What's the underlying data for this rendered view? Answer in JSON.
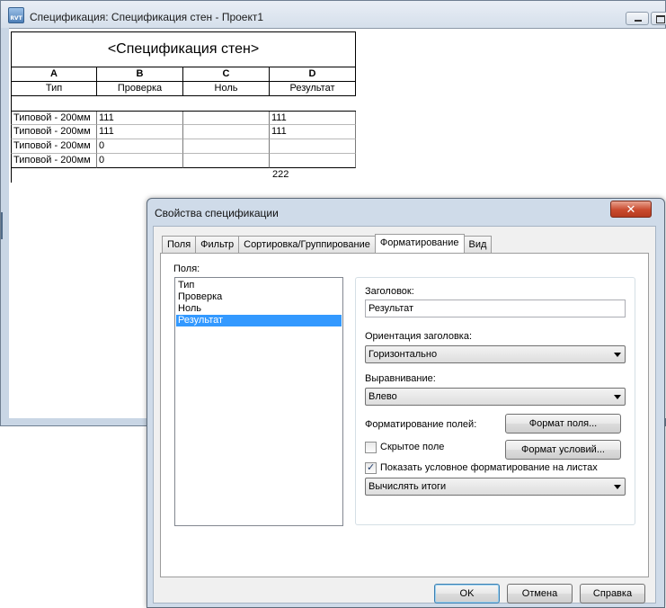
{
  "main_window": {
    "title": "Спецификация: Спецификация стен - Проект1",
    "icon_text": "RVT"
  },
  "schedule": {
    "title": "<Спецификация стен>",
    "column_letters": [
      "A",
      "B",
      "C",
      "D"
    ],
    "headers": [
      "Тип",
      "Проверка",
      "Ноль",
      "Результат"
    ],
    "rows": [
      [
        "Типовой - 200мм",
        "111",
        "",
        "111"
      ],
      [
        "Типовой - 200мм",
        "111",
        "",
        "111"
      ],
      [
        "Типовой - 200мм",
        "0",
        "",
        ""
      ],
      [
        "Типовой - 200мм",
        "0",
        "",
        ""
      ]
    ],
    "total": "222"
  },
  "dialog": {
    "title": "Свойства спецификации",
    "close_glyph": "✕",
    "tabs": [
      "Поля",
      "Фильтр",
      "Сортировка/Группирование",
      "Форматирование",
      "Вид"
    ],
    "active_tab": "Форматирование",
    "fields_label": "Поля:",
    "fields": [
      "Тип",
      "Проверка",
      "Ноль",
      "Результат"
    ],
    "selected_field": "Результат",
    "heading_label": "Заголовок:",
    "heading_value": "Результат",
    "orientation_label": "Ориентация заголовка:",
    "orientation_value": "Горизонтально",
    "alignment_label": "Выравнивание:",
    "alignment_value": "Влево",
    "field_format_label": "Форматирование полей:",
    "field_format_button": "Формат поля...",
    "hidden_field_label": "Скрытое поле",
    "hidden_field_checked": false,
    "conditional_format_button": "Формат условий...",
    "show_conditional_label": "Показать условное форматирование на листах",
    "show_conditional_checked": true,
    "totals_value": "Вычислять итоги",
    "ok_button": "OK",
    "cancel_button": "Отмена",
    "help_button": "Справка"
  },
  "colors": {
    "selection": "#3399ff",
    "close_button": "#c94a2e",
    "window_frame": "#c9d6e5"
  }
}
